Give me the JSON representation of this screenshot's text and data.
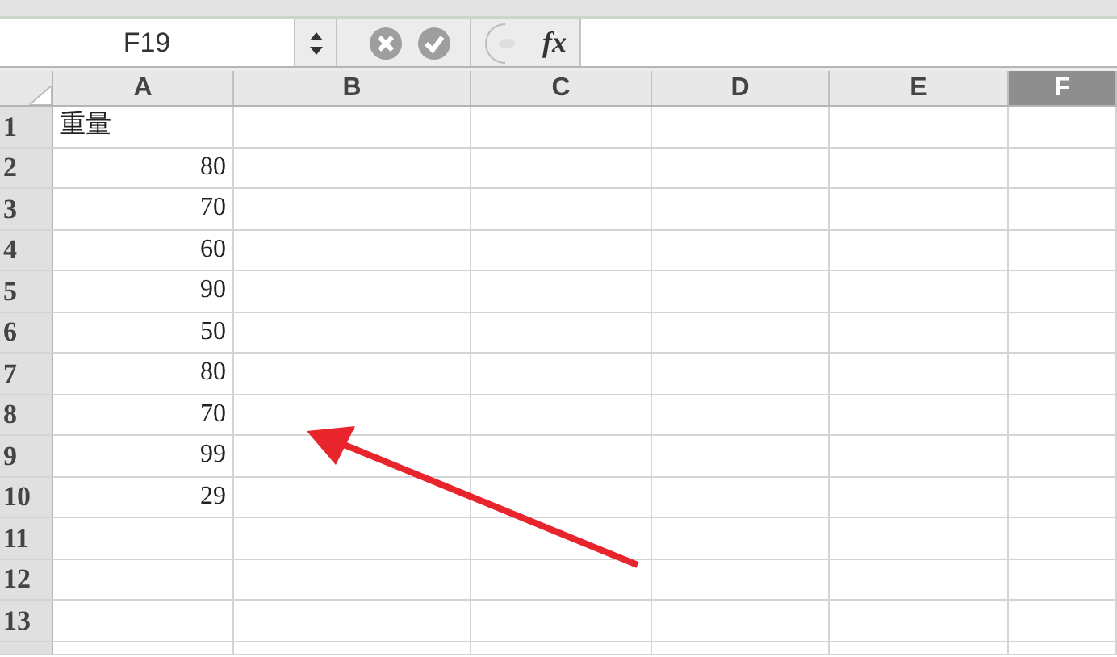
{
  "formula_bar": {
    "name_box": "F19",
    "fx": "fx"
  },
  "columns": [
    {
      "label": "A",
      "selected": false
    },
    {
      "label": "B",
      "selected": false
    },
    {
      "label": "C",
      "selected": false
    },
    {
      "label": "D",
      "selected": false
    },
    {
      "label": "E",
      "selected": false
    },
    {
      "label": "F",
      "selected": true
    }
  ],
  "rows": [
    {
      "number": "1",
      "cell_a": "重量",
      "selected": false
    },
    {
      "number": "2",
      "cell_a": "80",
      "selected": false
    },
    {
      "number": "3",
      "cell_a": "70",
      "selected": false
    },
    {
      "number": "4",
      "cell_a": "60",
      "selected": false
    },
    {
      "number": "5",
      "cell_a": "90",
      "selected": false
    },
    {
      "number": "6",
      "cell_a": "50",
      "selected": false
    },
    {
      "number": "7",
      "cell_a": "80",
      "selected": false
    },
    {
      "number": "8",
      "cell_a": "70",
      "selected": false
    },
    {
      "number": "9",
      "cell_a": "99",
      "selected": false
    },
    {
      "number": "10",
      "cell_a": "29",
      "selected": false
    },
    {
      "number": "11",
      "selected": false
    },
    {
      "number": "12",
      "selected": false
    },
    {
      "number": "13",
      "selected": false
    }
  ]
}
